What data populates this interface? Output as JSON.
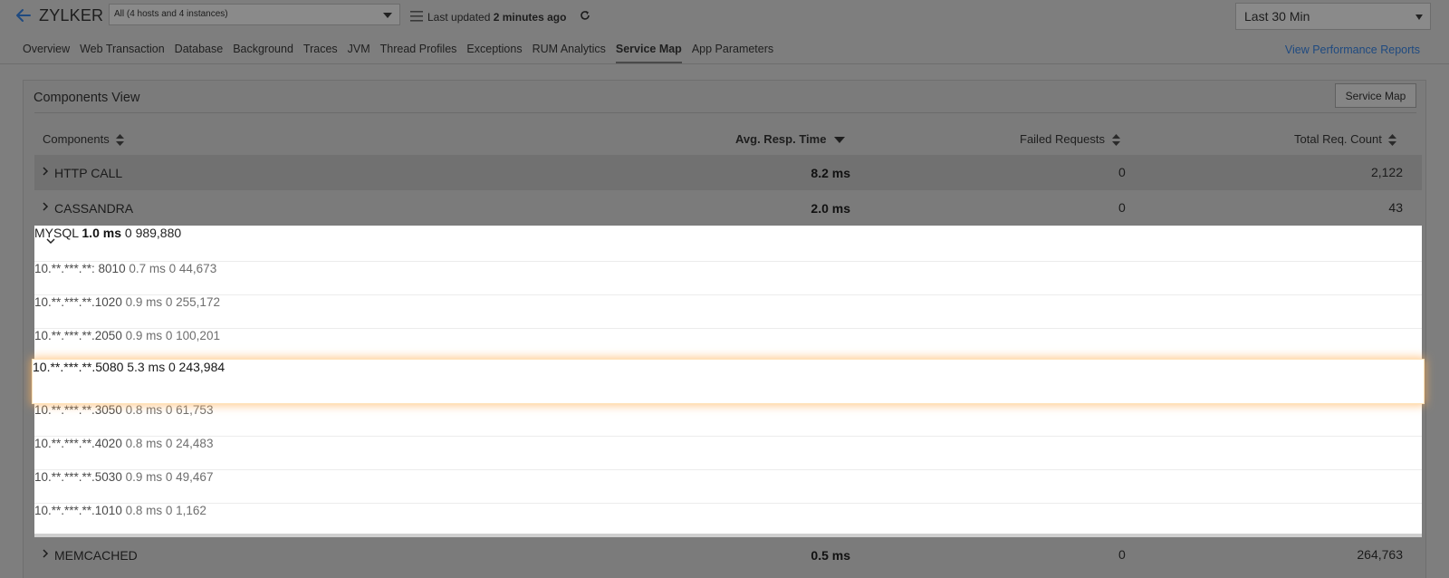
{
  "header": {
    "app_title": "ZYLKER",
    "instance_filter": "All (4 hosts and 4 instances)",
    "last_updated_prefix": "Last updated",
    "last_updated_value": "2 minutes ago",
    "time_range": "Last 30 Min",
    "view_reports_link": "View Performance Reports"
  },
  "tabs": [
    {
      "label": "Overview"
    },
    {
      "label": "Web Transaction"
    },
    {
      "label": "Database"
    },
    {
      "label": "Background"
    },
    {
      "label": "Traces"
    },
    {
      "label": "JVM"
    },
    {
      "label": "Thread Profiles"
    },
    {
      "label": "Exceptions"
    },
    {
      "label": "RUM Analytics"
    },
    {
      "label": "Service Map",
      "active": true
    },
    {
      "label": "App Parameters"
    }
  ],
  "panel": {
    "title": "Components View",
    "service_map_button": "Service Map",
    "columns": {
      "components": "Components",
      "avg_resp_time": "Avg. Resp. Time",
      "failed_requests": "Failed Requests",
      "total_req_count": "Total Req. Count"
    },
    "groups": {
      "http_call": {
        "name": "HTTP CALL",
        "avg": "8.2 ms",
        "failed": "0",
        "total": "2,122"
      },
      "cassandra": {
        "name": "CASSANDRA",
        "avg": "2.0 ms",
        "failed": "0",
        "total": "43"
      },
      "mysql": {
        "name": "MYSQL",
        "avg": "1.0 ms",
        "failed": "0",
        "total": "989,880"
      },
      "memcached": {
        "name": "MEMCACHED",
        "avg": "0.5 ms",
        "failed": "0",
        "total": "264,763"
      }
    },
    "mysql_instances": [
      {
        "name": "10.**.***.**: 8010",
        "avg": "0.7 ms",
        "failed": "0",
        "total": "44,673"
      },
      {
        "name": "10.**.***.**.1020",
        "avg": "0.9 ms",
        "failed": "0",
        "total": "255,172"
      },
      {
        "name": "10.**.***.**.2050",
        "avg": "0.9 ms",
        "failed": "0",
        "total": "100,201"
      },
      {
        "name": "10.**.***.**.5080",
        "avg": "5.3 ms",
        "failed": "0",
        "total": "243,984"
      },
      {
        "name": "10.**.***.**.3050",
        "avg": "0.8 ms",
        "failed": "0",
        "total": "61,753"
      },
      {
        "name": "10.**.***.**.4020",
        "avg": "0.8 ms",
        "failed": "0",
        "total": "24,483"
      },
      {
        "name": "10.**.***.**.5030",
        "avg": "0.9 ms",
        "failed": "0",
        "total": "49,467"
      },
      {
        "name": "10.**.***.**.1010",
        "avg": "0.8 ms",
        "failed": "0",
        "total": "1,162"
      }
    ]
  },
  "icons": {
    "back": "arrow-left-icon",
    "menu": "menu-icon",
    "refresh": "refresh-icon",
    "sort": "sort-icon",
    "expand": "chevron-right-icon",
    "collapse": "chevron-down-icon"
  },
  "colors": {
    "link": "#1f4a80",
    "highlight_glow": "#ffb05a"
  }
}
